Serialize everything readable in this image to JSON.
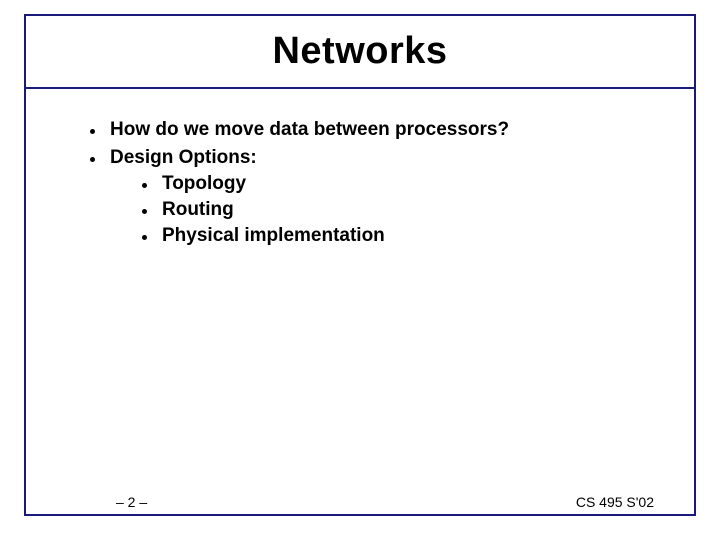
{
  "title": "Networks",
  "bullets": [
    {
      "text": "How do we move data between processors?"
    },
    {
      "text": "Design Options:",
      "children": [
        {
          "text": "Topology"
        },
        {
          "text": "Routing"
        },
        {
          "text": "Physical implementation"
        }
      ]
    }
  ],
  "footer": {
    "page": "– 2 –",
    "course": "CS 495 S'02"
  }
}
